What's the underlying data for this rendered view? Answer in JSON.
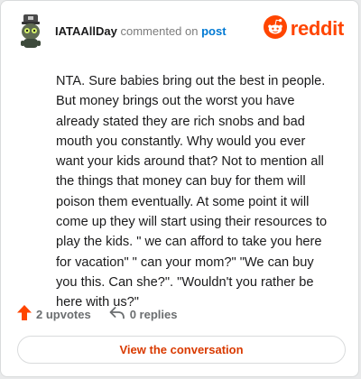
{
  "header": {
    "username": "IATAAllDay",
    "action": "commented on",
    "post_link": "post",
    "brand": "reddit"
  },
  "comment": {
    "body": "NTA. Sure babies bring out the best in people. But money brings out the worst you have already stated they are rich snobs and bad mouth you constantly. Why would you ever want your kids around that? Not to mention all the things that money can buy for them will poison them eventually. At some point it will come up they will start using their resources to play the kids. \" we can afford to take you here for vacation\" \" can your mom?\" \"We can buy you this. Can she?\". \"Wouldn't you rather be here with us?\""
  },
  "actions": {
    "upvotes": "2 upvotes",
    "replies": "0 replies"
  },
  "cta": {
    "label": "View the conversation"
  },
  "colors": {
    "brand": "#ff4500",
    "link": "#0079d3",
    "cta_text": "#d93a00",
    "upvote_icon": "#ff4500"
  },
  "icons": [
    "avatar",
    "reddit-logo-icon",
    "upvote-arrow-icon",
    "reply-arrow-icon"
  ]
}
